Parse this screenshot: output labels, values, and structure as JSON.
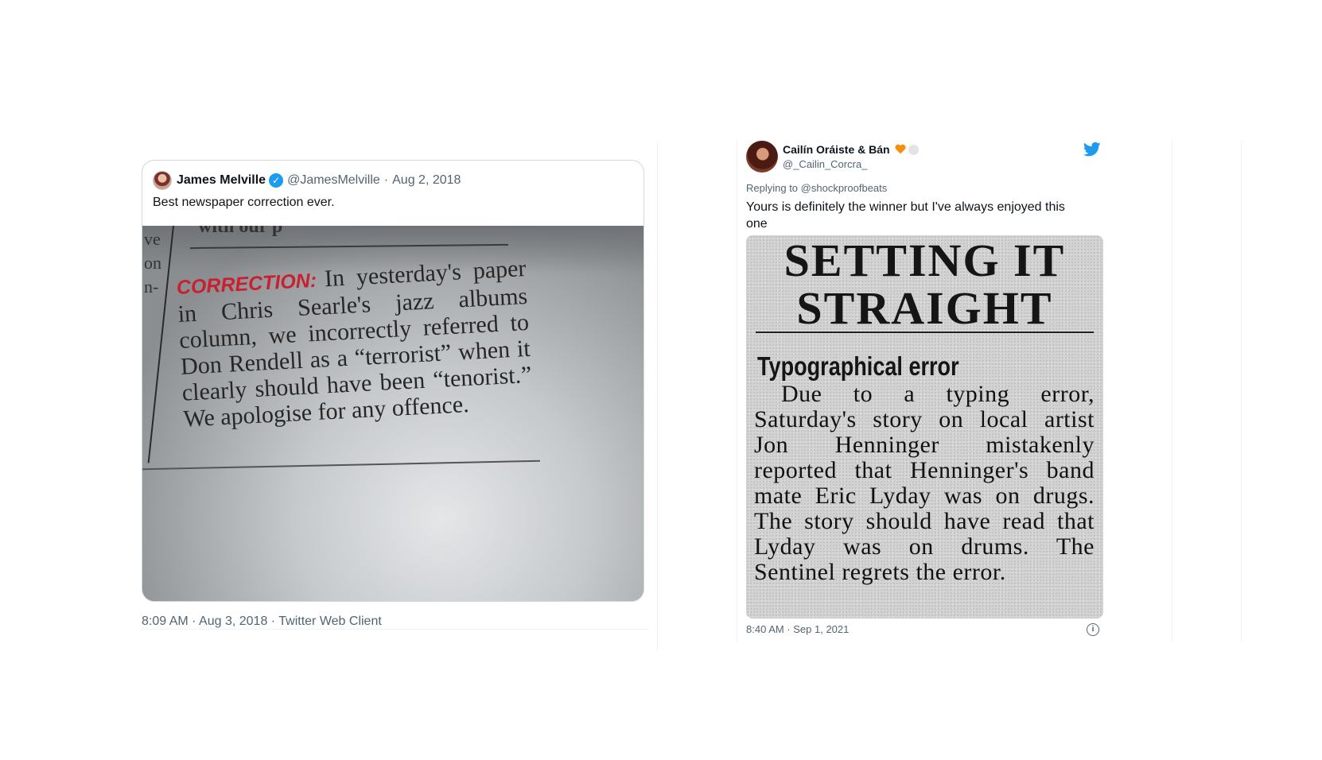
{
  "left_tweet": {
    "quoted": {
      "name": "James Melville",
      "handle": "@JamesMelville",
      "separator": "·",
      "date": "Aug 2, 2018",
      "text": "Best newspaper correction ever.",
      "image": {
        "label": "CORRECTION:",
        "body": "In yesterday's paper in Chris Searle's jazz albums column, we incorrectly referred to Don Rendell as a “terrorist” when it clearly should have been “tenorist.” We apologise for any offence.",
        "top_fragment": "with our p",
        "margin_fragment_1": "ve",
        "margin_fragment_2": "on",
        "margin_fragment_3": "n-"
      }
    },
    "meta": "8:09 AM · Aug 3, 2018 · Twitter Web Client"
  },
  "right_tweet": {
    "name": "Cailín Oráiste & Bán",
    "handle": "@_Cailin_Corcra_",
    "replying_prefix": "Replying to",
    "replying_to": "@shockproofbeats",
    "text": "Yours is definitely the winner but I've always enjoyed this one",
    "image": {
      "headline_line1": "SETTING IT",
      "headline_line2": "STRAIGHT",
      "subhead": "Typographical error",
      "body": "Due to a typing error, Saturday's story on local artist Jon Henninger mistakenly reported that Henninger's band mate Eric Lyday was on drugs. The story should have read that Lyday was on drums. The Sentinel regrets the error."
    },
    "meta": "8:40 AM · Sep 1, 2021",
    "info_symbol": "i"
  },
  "colors": {
    "twitter_blue": "#1d9bf0",
    "secondary_text": "#536471",
    "correction_red": "#c8202e",
    "heart_orange": "#f4900c"
  },
  "icons": {
    "verified": "verified-badge-icon",
    "bird": "twitter-bird-icon",
    "heart": "orange-heart-icon",
    "info": "info-icon"
  }
}
